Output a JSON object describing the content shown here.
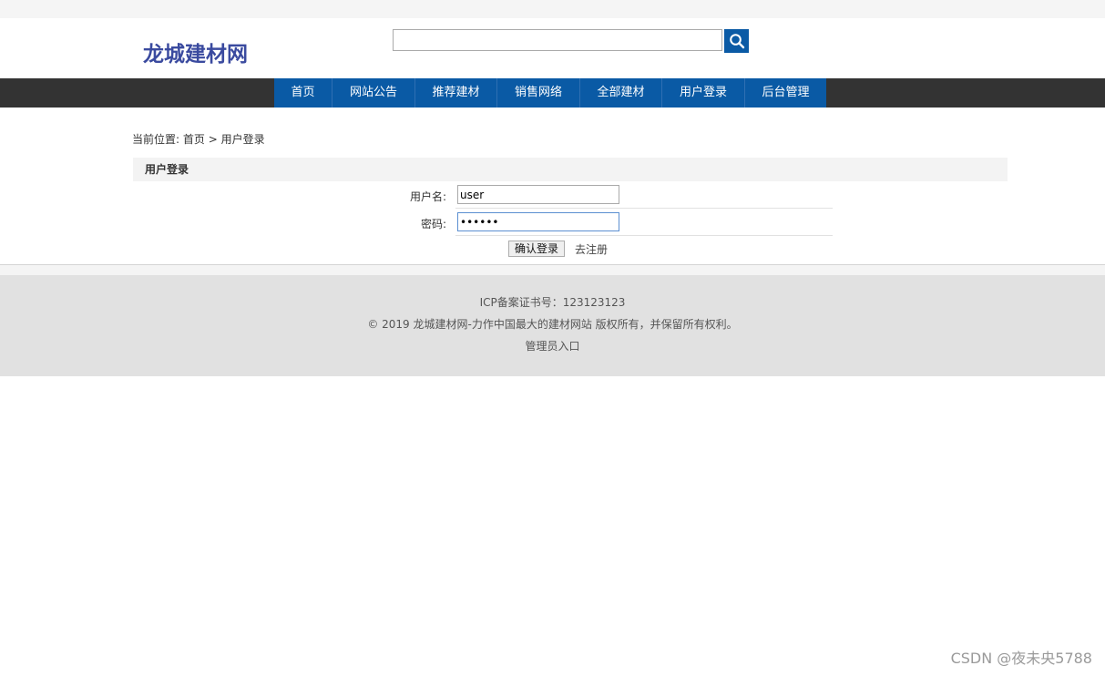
{
  "site": {
    "logo": "龙城建材网"
  },
  "search": {
    "value": "",
    "placeholder": "",
    "button_icon": "search-icon"
  },
  "nav": {
    "items": [
      {
        "label": "首页"
      },
      {
        "label": "网站公告"
      },
      {
        "label": "推荐建材"
      },
      {
        "label": "销售网络"
      },
      {
        "label": "全部建材"
      },
      {
        "label": "用户登录"
      },
      {
        "label": "后台管理"
      }
    ]
  },
  "breadcrumb": {
    "prefix": "当前位置:",
    "home": "首页",
    "separator": ">",
    "current": "用户登录"
  },
  "panel": {
    "title": "用户登录"
  },
  "form": {
    "username_label": "用户名:",
    "username_value": "user",
    "password_label": "密码:",
    "password_value": "111111",
    "submit_label": "确认登录",
    "register_label": "去注册"
  },
  "footer": {
    "icp": "ICP备案证书号：123123123",
    "copyright": "© 2019 龙城建材网-力作中国最大的建材网站 版权所有，并保留所有权利。",
    "admin_link": "管理员入口"
  },
  "watermark": "CSDN @夜未央5788",
  "colors": {
    "brand_blue": "#0a5aa5",
    "logo_text": "#3a4a9f",
    "navbar_bg": "#333333",
    "footer_bg": "#e1e1e1"
  }
}
